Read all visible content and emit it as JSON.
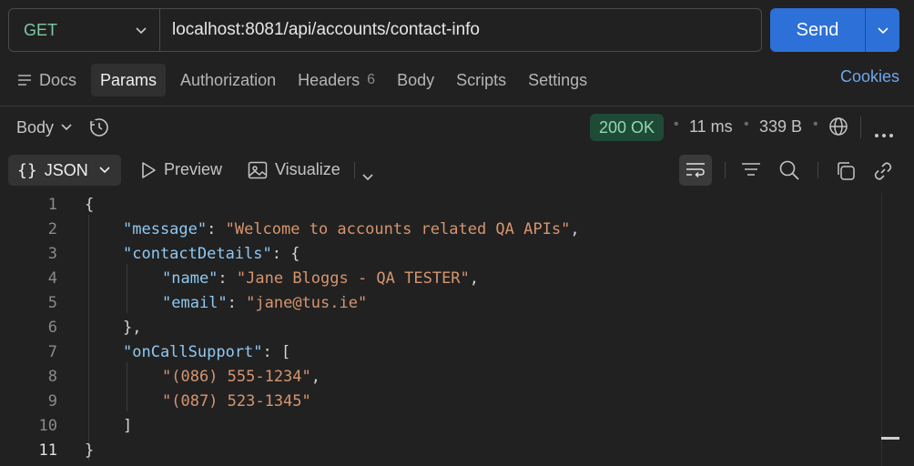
{
  "request": {
    "method": "GET",
    "url": "localhost:8081/api/accounts/contact-info",
    "send_label": "Send"
  },
  "tabs": [
    {
      "label": "Docs"
    },
    {
      "label": "Params"
    },
    {
      "label": "Authorization"
    },
    {
      "label": "Headers",
      "count": "6"
    },
    {
      "label": "Body"
    },
    {
      "label": "Scripts"
    },
    {
      "label": "Settings"
    }
  ],
  "active_tab": "Params",
  "cookies_label": "Cookies",
  "response": {
    "body_label": "Body",
    "status": "200 OK",
    "time": "11 ms",
    "size": "339 B"
  },
  "toolbar": {
    "format_label": "JSON",
    "preview_label": "Preview",
    "visualize_label": "Visualize"
  },
  "code": {
    "line_numbers": [
      "1",
      "2",
      "3",
      "4",
      "5",
      "6",
      "7",
      "8",
      "9",
      "10",
      "11"
    ],
    "l1": "{",
    "l2_key": "\"message\"",
    "l2_val": "\"Welcome to accounts related QA APIs\"",
    "l3_key": "\"contactDetails\"",
    "l3_punct": ": {",
    "l4_key": "\"name\"",
    "l4_val": "\"Jane Bloggs - QA TESTER\"",
    "l5_key": "\"email\"",
    "l5_val": "\"jane@tus.ie\"",
    "l6": "},",
    "l7_key": "\"onCallSupport\"",
    "l7_punct": ": [",
    "l8_val": "\"(086) 555-1234\"",
    "l9_val": "\"(087) 523-1345\"",
    "l10": "]",
    "l11": "}"
  },
  "colors": {
    "accent": "#2d70d8",
    "status_bg": "#1f4a36",
    "status_text": "#8fd9b4",
    "json_key": "#8fc8f2",
    "json_string": "#d69570",
    "method": "#7ec9a6",
    "link": "#6ea6ef"
  }
}
